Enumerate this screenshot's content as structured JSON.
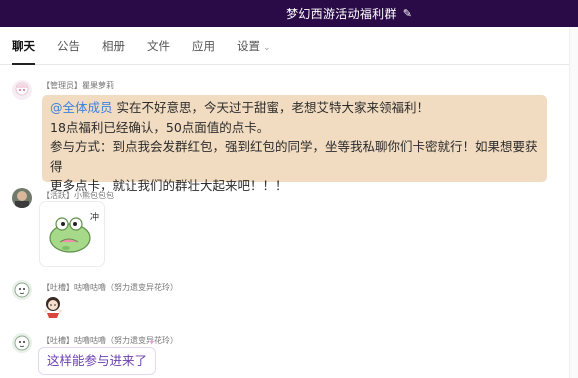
{
  "header": {
    "title": "梦幻西游活动福利群",
    "edit_icon": "pencil-icon"
  },
  "tabs": [
    {
      "label": "聊天",
      "active": true
    },
    {
      "label": "公告"
    },
    {
      "label": "相册"
    },
    {
      "label": "文件"
    },
    {
      "label": "应用"
    },
    {
      "label": "设置"
    }
  ],
  "messages": [
    {
      "sender": "【管理员】瞿果萝莉",
      "mention": "@全体成员",
      "lines": [
        " 实在不好意思，今天过于甜蜜，老想艾特大家来领福利！",
        "18点福利已经确认，50点面值的点卡。",
        "参与方式：到点我会发群红包，强到红包的同学，坐等我私聊你们卡密就行！如果想要获得",
        "更多点卡，就让我们的群壮大起来吧！！！"
      ]
    },
    {
      "sender": "【活跃】小熊包包包",
      "sticker": "frog-sticker",
      "sticker_text": "冲"
    },
    {
      "sender": "【吐槽】咕噜咕噜（努力遗变异花玲）",
      "sticker": "girl-sticker"
    },
    {
      "sender": "【吐槽】咕噜咕噜（努力遗变异花玲）",
      "text": "这样能参与进来了"
    }
  ]
}
